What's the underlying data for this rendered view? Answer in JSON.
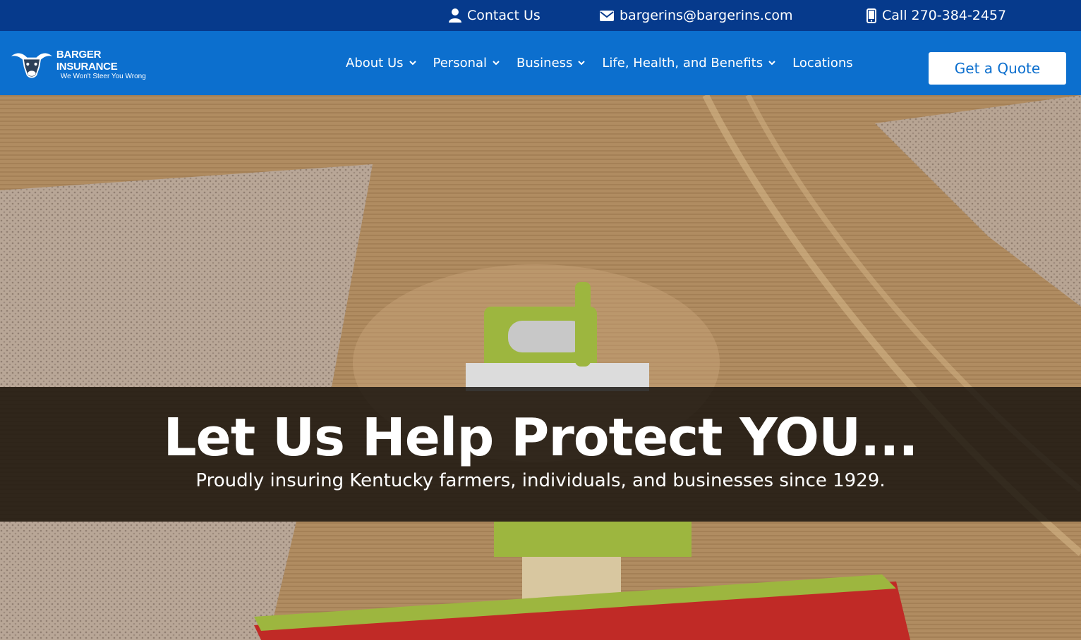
{
  "topbar": {
    "contact_label": "Contact Us",
    "email": "bargerins@bargerins.com",
    "phone_label": "Call 270-384-2457"
  },
  "logo": {
    "name": "BARGER INSURANCE",
    "tagline": "We Won't Steer You Wrong"
  },
  "nav": {
    "items": [
      {
        "label": "About Us",
        "has_dropdown": true
      },
      {
        "label": "Personal",
        "has_dropdown": true
      },
      {
        "label": "Business",
        "has_dropdown": true
      },
      {
        "label": "Life, Health, and Benefits",
        "has_dropdown": true
      },
      {
        "label": "Locations",
        "has_dropdown": false
      }
    ],
    "cta_label": "Get a Quote"
  },
  "hero": {
    "title": "Let Us Help Protect YOU...",
    "subtitle": "Proudly insuring Kentucky farmers, individuals, and businesses since 1929."
  },
  "colors": {
    "topbar_bg": "#063a8c",
    "nav_bg": "#0c6fce",
    "cta_text": "#0c6fce"
  },
  "icons": {
    "contact": "user-icon",
    "email": "envelope-icon",
    "phone": "mobile-phone-icon",
    "dropdown": "chevron-down-icon",
    "logo": "longhorn-bull-icon"
  }
}
